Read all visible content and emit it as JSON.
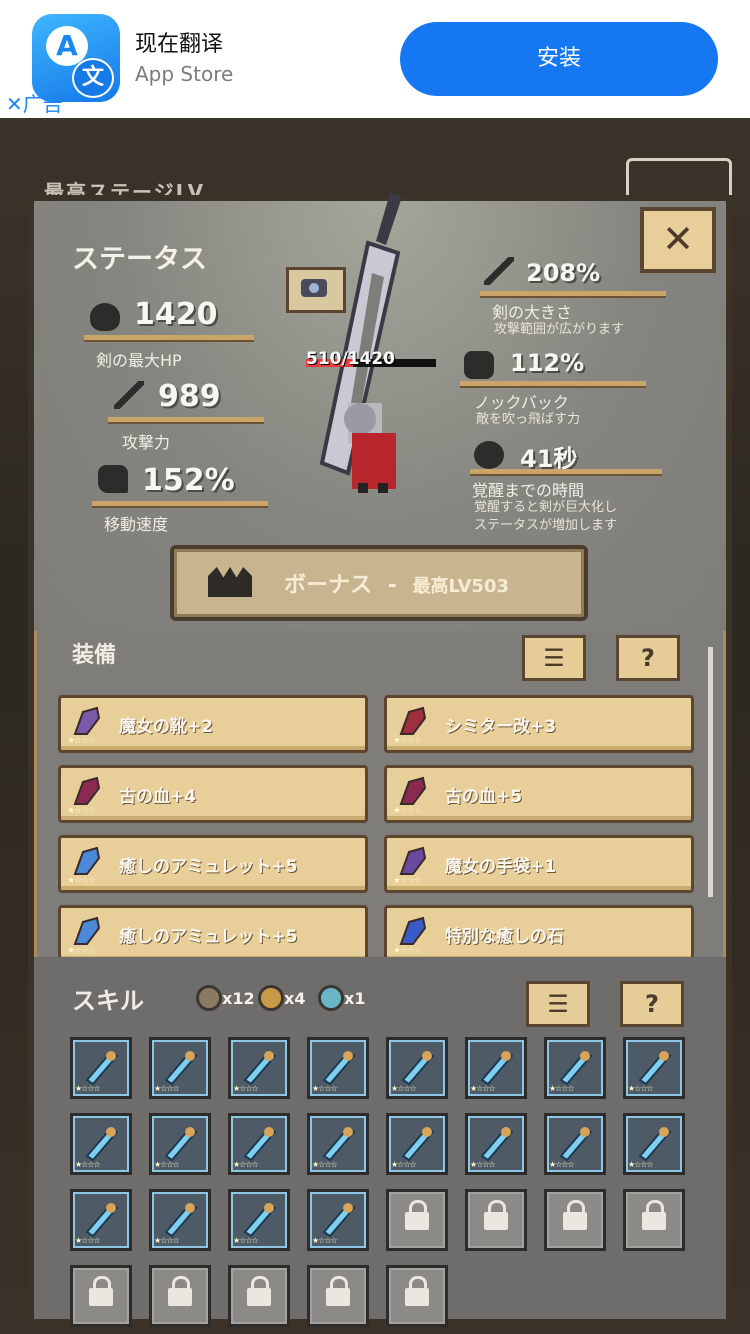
{
  "ad": {
    "app_name": "现在翻译",
    "store": "App Store",
    "install_label": "安装",
    "close_label": "✕广告",
    "icon_letter_a": "A",
    "icon_letter_b": "文"
  },
  "background": {
    "partial_text": "最高ステージLV"
  },
  "status": {
    "title": "ステータス",
    "close_label": "✕",
    "hp_display": "510/1420",
    "hp_fraction": 0.36,
    "left_stats": [
      {
        "value": "1420",
        "label": "剣の最大HP",
        "icon": "heart-icon"
      },
      {
        "value": "989",
        "label": "攻撃力",
        "icon": "sword-icon"
      },
      {
        "value": "152%",
        "label": "移動速度",
        "icon": "boot-icon"
      }
    ],
    "right_stats": [
      {
        "value": "208%",
        "label": "剣の大きさ",
        "desc": "攻撃範囲が広がります",
        "icon": "sword-icon"
      },
      {
        "value": "112%",
        "label": "ノックバック",
        "desc": "敵を吹っ飛ばす力",
        "icon": "fist-icon"
      },
      {
        "value": "41秒",
        "label": "覚醒までの時間",
        "desc": "覚醒すると剣が巨大化し",
        "desc2": "ステータスが増加します",
        "icon": "awaken-icon"
      }
    ],
    "bonus": {
      "label": "ボーナス",
      "separator": "-",
      "level": "最高LV503"
    }
  },
  "equipment": {
    "title": "装備",
    "list_label": "☰",
    "help_label": "?",
    "items": [
      {
        "name": "魔女の靴+2",
        "icon": "boot-icon",
        "color": "#7a5aa8"
      },
      {
        "name": "シミター改+3",
        "icon": "scimitar-icon",
        "color": "#a03040"
      },
      {
        "name": "古の血+4",
        "icon": "blood-icon",
        "color": "#8a2a50"
      },
      {
        "name": "古の血+5",
        "icon": "blood-icon",
        "color": "#8a2a50"
      },
      {
        "name": "癒しのアミュレット+5",
        "icon": "amulet-icon",
        "color": "#4a8ad8"
      },
      {
        "name": "魔女の手袋+1",
        "icon": "glove-icon",
        "color": "#6a4aa0"
      },
      {
        "name": "癒しのアミュレット+5",
        "icon": "amulet-icon",
        "color": "#4a8ad8"
      },
      {
        "name": "特別な癒しの石",
        "icon": "stone-icon",
        "color": "#3a5ac8"
      }
    ]
  },
  "skills": {
    "title": "スキル",
    "list_label": "☰",
    "help_label": "?",
    "currencies": [
      {
        "count": "x12",
        "color": "#8a7a62"
      },
      {
        "count": "x4",
        "color": "#c89a48"
      },
      {
        "count": "x1",
        "color": "#6ab6c8"
      }
    ],
    "slots": [
      "sword-skill-icon",
      "wand-skill-icon",
      "bow-skill-icon",
      "splash-skill-icon",
      "scroll-skill-icon",
      "bow-skill-icon",
      "axe-skill-icon",
      "scroll-skill-icon",
      "scroll-skill-icon",
      "scroll-skill-icon",
      "scroll-skill-icon",
      "splash-skill-icon",
      "scroll-skill-icon",
      "crossbow-skill-icon",
      "sword-skill-icon",
      "crossbow-skill-icon",
      "gem-skill-icon",
      "axe-skill-icon",
      "scroll-skill-icon",
      "wand-skill-icon",
      "lock-icon",
      "lock-icon",
      "lock-icon",
      "lock-icon",
      "lock-icon",
      "lock-icon",
      "lock-icon",
      "lock-icon",
      "lock-icon"
    ]
  }
}
